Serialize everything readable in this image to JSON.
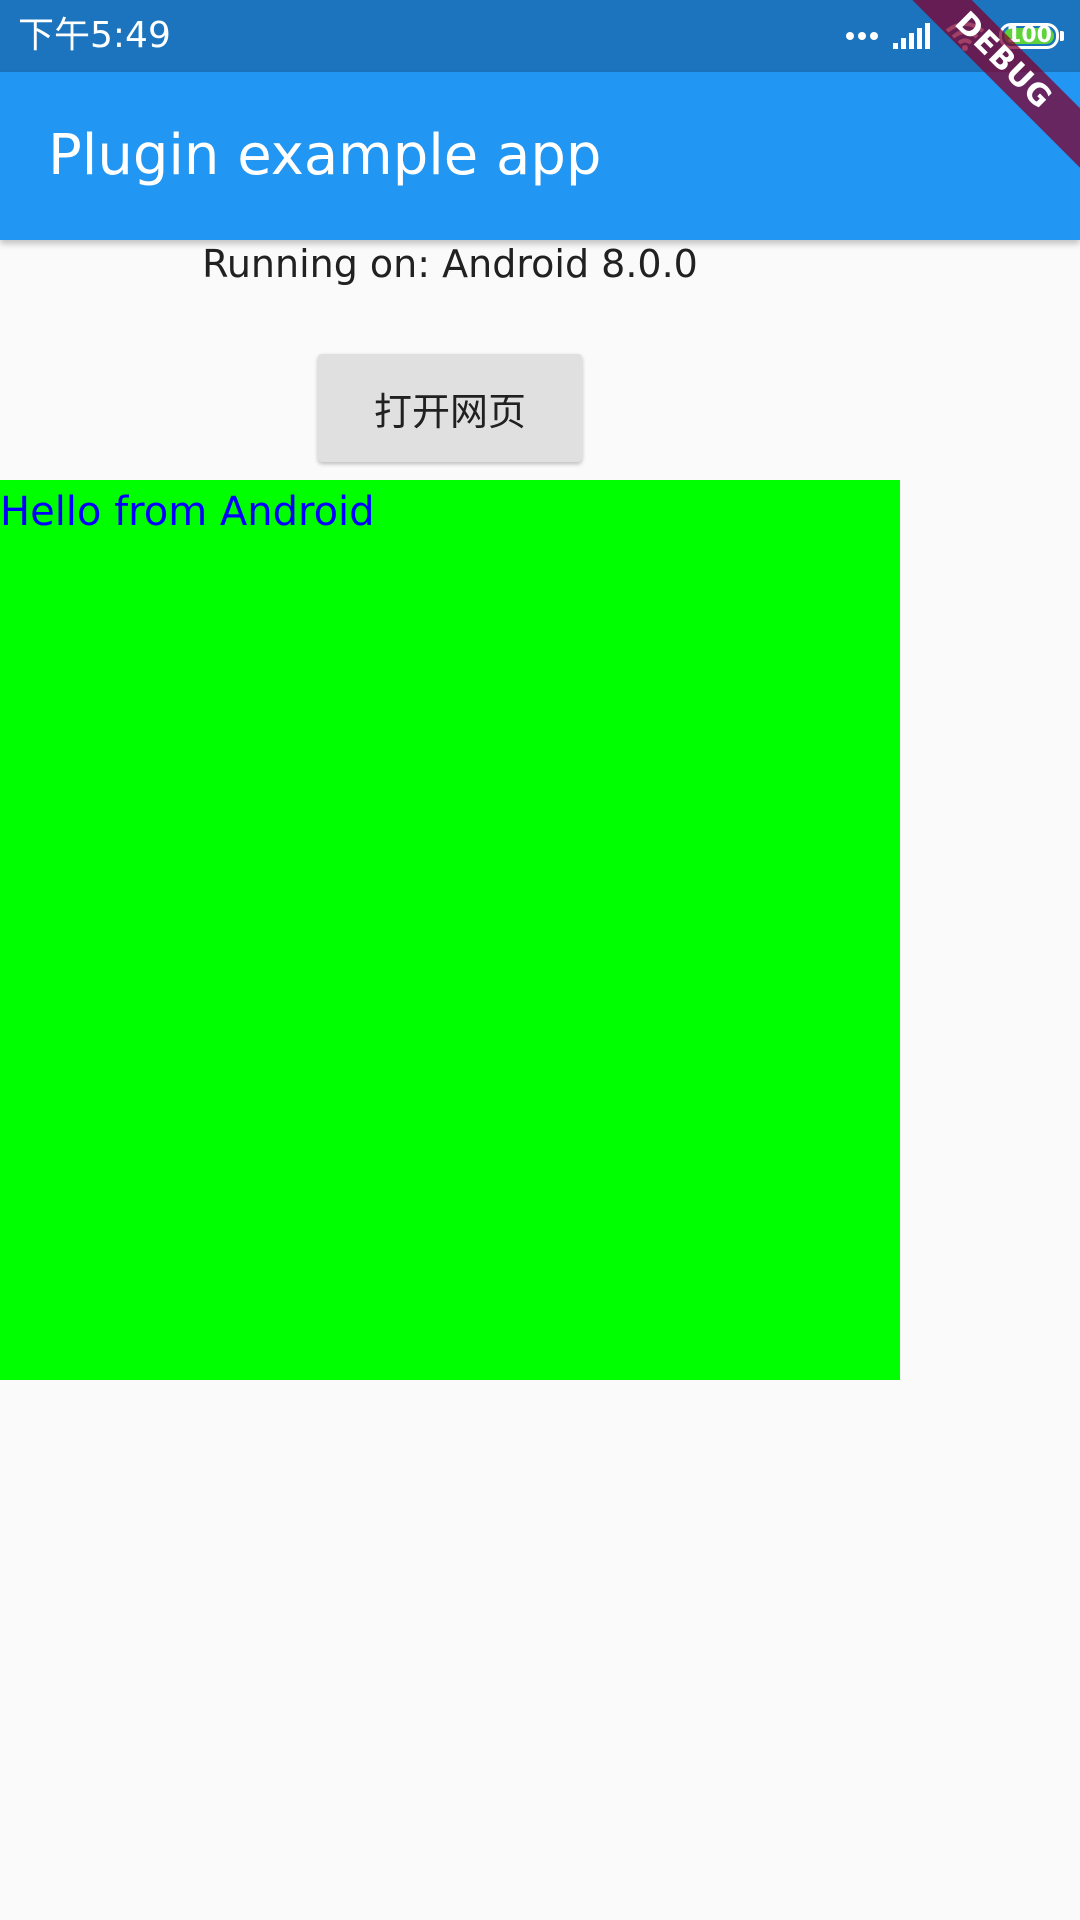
{
  "status_bar": {
    "time": "下午5:49",
    "battery_level": "100",
    "icons": [
      "dots-icon",
      "signal-icon",
      "wifi-icon",
      "battery-icon"
    ]
  },
  "app_bar": {
    "title": "Plugin example app"
  },
  "debug_banner": {
    "label": "DEBUG"
  },
  "main": {
    "running_text": "Running on: Android 8.0.0",
    "open_button_label": "打开网页",
    "native_view": {
      "text": "Hello from Android",
      "background_color": "#00ff00",
      "text_color": "#0000ff"
    }
  },
  "colors": {
    "status_bar": "#1b74bd",
    "app_bar": "#2196f3",
    "button": "#e0e0e0",
    "background": "#fafafa"
  }
}
